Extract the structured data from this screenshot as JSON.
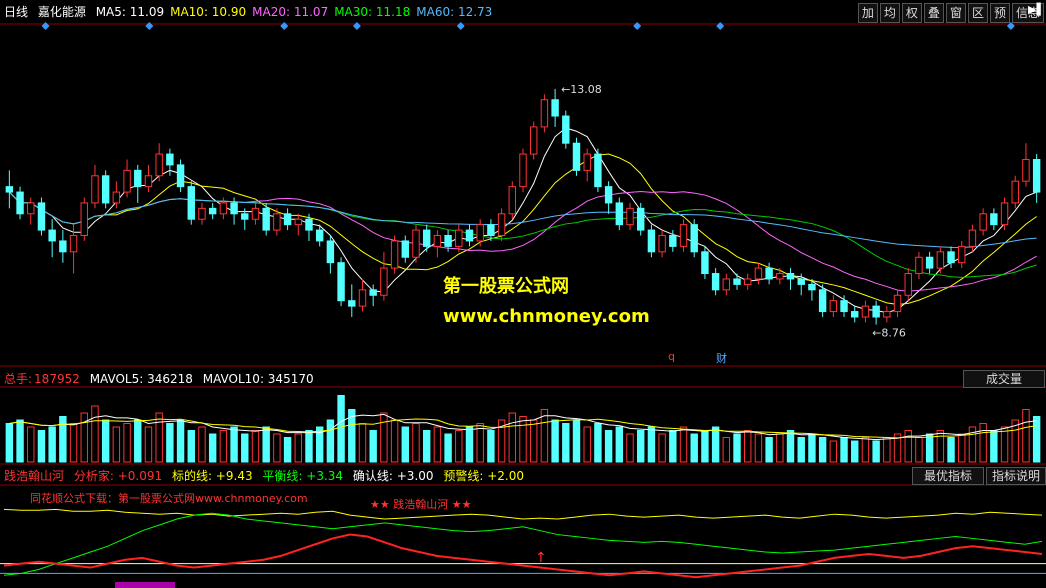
{
  "top_header": {
    "period": "日线",
    "stock": "嘉化能源",
    "ma": [
      {
        "label": "MA5: 11.09",
        "color": "#ffffff"
      },
      {
        "label": "MA10: 10.90",
        "color": "#ffff00"
      },
      {
        "label": "MA20: 11.07",
        "color": "#ff66ff"
      },
      {
        "label": "MA30: 11.18",
        "color": "#00ff00"
      },
      {
        "label": "MA60: 12.73",
        "color": "#55bbff"
      }
    ]
  },
  "toolbar": [
    "加",
    "均",
    "权",
    "叠",
    "窗",
    "区",
    "预",
    "信息"
  ],
  "watermark": {
    "title": "第一股票公式网",
    "url": "www.chnmoney.com"
  },
  "marker_labels": {
    "q": "q",
    "cai": "财"
  },
  "vol_header": {
    "total_label": "总手:",
    "total_value": "187952",
    "mavol5": "MAVOL5: 346218",
    "mavol10": "MAVOL10: 345170",
    "dropdown": "成交量"
  },
  "ind_header": {
    "name": "践浩翰山河",
    "fen": "分析家: +0.091",
    "biaode": "标的线: +9.43",
    "pingheng": "平衡线: +3.34",
    "queren": "确认线: +3.00",
    "yujing": "预警线: +2.00",
    "best_btn": "最优指标",
    "desc_btn": "指标说明"
  },
  "ind_note": "同花顺公式下载：第一股票公式网www.chnmoney.com",
  "ind_star_label": "践浩翰山河",
  "chart_data": {
    "type": "candlestick",
    "price_range": [
      8.2,
      14.0
    ],
    "high_label": "13.08",
    "low_label": "8.76",
    "diamond_positions": [
      0.04,
      0.14,
      0.27,
      0.34,
      0.44,
      0.61,
      0.69,
      0.97
    ],
    "ohlc": [
      [
        11.3,
        11.2,
        11.6,
        10.9
      ],
      [
        11.2,
        10.8,
        11.3,
        10.7
      ],
      [
        10.8,
        11.0,
        11.1,
        10.6
      ],
      [
        11.0,
        10.5,
        11.1,
        10.4
      ],
      [
        10.5,
        10.3,
        10.7,
        10.0
      ],
      [
        10.3,
        10.1,
        10.5,
        9.9
      ],
      [
        10.1,
        10.4,
        10.6,
        9.7
      ],
      [
        10.4,
        11.0,
        11.1,
        10.3
      ],
      [
        11.0,
        11.5,
        11.7,
        10.9
      ],
      [
        11.5,
        11.0,
        11.6,
        10.9
      ],
      [
        11.0,
        11.2,
        11.4,
        10.9
      ],
      [
        11.2,
        11.6,
        11.8,
        11.1
      ],
      [
        11.6,
        11.3,
        11.7,
        11.0
      ],
      [
        11.3,
        11.5,
        11.7,
        11.2
      ],
      [
        11.5,
        11.9,
        12.1,
        11.4
      ],
      [
        11.9,
        11.7,
        12.0,
        11.5
      ],
      [
        11.7,
        11.3,
        11.8,
        11.2
      ],
      [
        11.3,
        10.7,
        11.4,
        10.6
      ],
      [
        10.7,
        10.9,
        11.0,
        10.6
      ],
      [
        10.9,
        10.8,
        11.0,
        10.7
      ],
      [
        10.8,
        11.0,
        11.1,
        10.7
      ],
      [
        11.0,
        10.8,
        11.1,
        10.6
      ],
      [
        10.8,
        10.7,
        10.9,
        10.5
      ],
      [
        10.7,
        10.9,
        11.0,
        10.6
      ],
      [
        10.9,
        10.5,
        11.0,
        10.4
      ],
      [
        10.5,
        10.8,
        10.9,
        10.4
      ],
      [
        10.8,
        10.6,
        10.9,
        10.5
      ],
      [
        10.6,
        10.7,
        10.8,
        10.4
      ],
      [
        10.7,
        10.5,
        10.8,
        10.3
      ],
      [
        10.5,
        10.3,
        10.6,
        10.2
      ],
      [
        10.3,
        9.9,
        10.4,
        9.7
      ],
      [
        9.9,
        9.2,
        10.0,
        9.1
      ],
      [
        9.2,
        9.1,
        9.5,
        8.9
      ],
      [
        9.1,
        9.4,
        9.6,
        9.0
      ],
      [
        9.4,
        9.3,
        9.5,
        9.1
      ],
      [
        9.3,
        9.8,
        10.1,
        9.2
      ],
      [
        9.8,
        10.3,
        10.4,
        9.7
      ],
      [
        10.3,
        10.0,
        10.4,
        9.9
      ],
      [
        10.0,
        10.5,
        10.6,
        9.9
      ],
      [
        10.5,
        10.2,
        10.6,
        10.1
      ],
      [
        10.2,
        10.4,
        10.5,
        10.0
      ],
      [
        10.4,
        10.2,
        10.5,
        10.1
      ],
      [
        10.2,
        10.5,
        10.6,
        10.1
      ],
      [
        10.5,
        10.3,
        10.6,
        10.2
      ],
      [
        10.3,
        10.6,
        10.7,
        10.2
      ],
      [
        10.6,
        10.4,
        10.7,
        10.3
      ],
      [
        10.4,
        10.8,
        10.9,
        10.3
      ],
      [
        10.8,
        11.3,
        11.4,
        10.7
      ],
      [
        11.3,
        11.9,
        12.0,
        11.2
      ],
      [
        11.9,
        12.4,
        12.5,
        11.8
      ],
      [
        12.4,
        12.9,
        13.0,
        12.3
      ],
      [
        12.9,
        12.6,
        13.1,
        12.4
      ],
      [
        12.6,
        12.1,
        12.7,
        12.0
      ],
      [
        12.1,
        11.6,
        12.2,
        11.5
      ],
      [
        11.6,
        11.9,
        12.0,
        11.4
      ],
      [
        11.9,
        11.3,
        12.0,
        11.2
      ],
      [
        11.3,
        11.0,
        11.4,
        10.8
      ],
      [
        11.0,
        10.6,
        11.1,
        10.5
      ],
      [
        10.6,
        10.9,
        11.0,
        10.5
      ],
      [
        10.9,
        10.5,
        11.0,
        10.4
      ],
      [
        10.5,
        10.1,
        10.6,
        10.0
      ],
      [
        10.1,
        10.4,
        10.5,
        10.0
      ],
      [
        10.4,
        10.2,
        10.5,
        10.1
      ],
      [
        10.2,
        10.6,
        10.7,
        10.1
      ],
      [
        10.6,
        10.1,
        10.7,
        10.0
      ],
      [
        10.1,
        9.7,
        10.2,
        9.6
      ],
      [
        9.7,
        9.4,
        9.8,
        9.3
      ],
      [
        9.4,
        9.6,
        9.7,
        9.3
      ],
      [
        9.6,
        9.5,
        9.7,
        9.4
      ],
      [
        9.5,
        9.6,
        9.7,
        9.4
      ],
      [
        9.6,
        9.8,
        9.9,
        9.5
      ],
      [
        9.8,
        9.6,
        9.9,
        9.5
      ],
      [
        9.6,
        9.7,
        9.8,
        9.5
      ],
      [
        9.7,
        9.6,
        9.8,
        9.4
      ],
      [
        9.6,
        9.5,
        9.7,
        9.3
      ],
      [
        9.5,
        9.4,
        9.6,
        9.2
      ],
      [
        9.4,
        9.0,
        9.5,
        8.9
      ],
      [
        9.0,
        9.2,
        9.3,
        8.9
      ],
      [
        9.2,
        9.0,
        9.3,
        8.9
      ],
      [
        9.0,
        8.9,
        9.1,
        8.8
      ],
      [
        8.9,
        9.1,
        9.2,
        8.8
      ],
      [
        9.1,
        8.9,
        9.2,
        8.76
      ],
      [
        8.9,
        9.0,
        9.1,
        8.8
      ],
      [
        9.0,
        9.3,
        9.4,
        8.9
      ],
      [
        9.3,
        9.7,
        9.8,
        9.2
      ],
      [
        9.7,
        10.0,
        10.1,
        9.6
      ],
      [
        10.0,
        9.8,
        10.1,
        9.7
      ],
      [
        9.8,
        10.1,
        10.2,
        9.7
      ],
      [
        10.1,
        9.9,
        10.2,
        9.8
      ],
      [
        9.9,
        10.2,
        10.3,
        9.8
      ],
      [
        10.2,
        10.5,
        10.6,
        10.1
      ],
      [
        10.5,
        10.8,
        10.9,
        10.4
      ],
      [
        10.8,
        10.6,
        10.9,
        10.5
      ],
      [
        10.6,
        11.0,
        11.1,
        10.5
      ],
      [
        11.0,
        11.4,
        11.5,
        10.9
      ],
      [
        11.4,
        11.8,
        12.1,
        11.3
      ],
      [
        11.8,
        11.2,
        11.9,
        11.0
      ]
    ],
    "volumes": [
      0.55,
      0.6,
      0.5,
      0.45,
      0.5,
      0.65,
      0.55,
      0.7,
      0.8,
      0.6,
      0.5,
      0.55,
      0.6,
      0.5,
      0.7,
      0.55,
      0.6,
      0.45,
      0.5,
      0.4,
      0.45,
      0.5,
      0.4,
      0.45,
      0.5,
      0.4,
      0.35,
      0.4,
      0.45,
      0.5,
      0.6,
      0.95,
      0.75,
      0.55,
      0.45,
      0.7,
      0.6,
      0.5,
      0.55,
      0.45,
      0.5,
      0.4,
      0.45,
      0.5,
      0.55,
      0.45,
      0.6,
      0.7,
      0.65,
      0.6,
      0.75,
      0.6,
      0.55,
      0.6,
      0.5,
      0.55,
      0.45,
      0.5,
      0.4,
      0.45,
      0.5,
      0.4,
      0.45,
      0.5,
      0.4,
      0.45,
      0.5,
      0.35,
      0.4,
      0.45,
      0.4,
      0.35,
      0.4,
      0.45,
      0.35,
      0.4,
      0.35,
      0.3,
      0.35,
      0.3,
      0.35,
      0.3,
      0.35,
      0.4,
      0.45,
      0.35,
      0.4,
      0.45,
      0.35,
      0.4,
      0.5,
      0.55,
      0.45,
      0.5,
      0.6,
      0.75,
      0.65
    ],
    "indicator": {
      "yellow": [
        0.78,
        0.77,
        0.77,
        0.78,
        0.76,
        0.76,
        0.77,
        0.75,
        0.74,
        0.73,
        0.74,
        0.72,
        0.73,
        0.71,
        0.72,
        0.73,
        0.74,
        0.73,
        0.75,
        0.76,
        0.72,
        0.7,
        0.68,
        0.69,
        0.7,
        0.71,
        0.72,
        0.73,
        0.72,
        0.7,
        0.68,
        0.69,
        0.68,
        0.7,
        0.72,
        0.73,
        0.71,
        0.7,
        0.71,
        0.72,
        0.7,
        0.69,
        0.7,
        0.71,
        0.72,
        0.7,
        0.69,
        0.71,
        0.73,
        0.72,
        0.7,
        0.69,
        0.7,
        0.71,
        0.72,
        0.74,
        0.73,
        0.75,
        0.74,
        0.73,
        0.72
      ],
      "green": [
        0.1,
        0.12,
        0.16,
        0.22,
        0.28,
        0.34,
        0.4,
        0.48,
        0.56,
        0.62,
        0.68,
        0.72,
        0.74,
        0.72,
        0.68,
        0.66,
        0.64,
        0.62,
        0.6,
        0.58,
        0.6,
        0.62,
        0.64,
        0.62,
        0.6,
        0.58,
        0.56,
        0.55,
        0.56,
        0.58,
        0.6,
        0.56,
        0.52,
        0.5,
        0.48,
        0.46,
        0.45,
        0.44,
        0.45,
        0.44,
        0.42,
        0.4,
        0.38,
        0.36,
        0.34,
        0.33,
        0.34,
        0.35,
        0.36,
        0.38,
        0.4,
        0.42,
        0.44,
        0.46,
        0.48,
        0.5,
        0.48,
        0.46,
        0.44,
        0.42,
        0.45
      ],
      "red": [
        0.2,
        0.22,
        0.24,
        0.22,
        0.2,
        0.18,
        0.22,
        0.26,
        0.28,
        0.24,
        0.2,
        0.18,
        0.2,
        0.22,
        0.24,
        0.26,
        0.3,
        0.36,
        0.42,
        0.48,
        0.52,
        0.5,
        0.44,
        0.38,
        0.34,
        0.3,
        0.28,
        0.26,
        0.24,
        0.22,
        0.2,
        0.18,
        0.16,
        0.14,
        0.12,
        0.1,
        0.12,
        0.14,
        0.12,
        0.1,
        0.08,
        0.1,
        0.12,
        0.14,
        0.16,
        0.18,
        0.2,
        0.24,
        0.28,
        0.3,
        0.32,
        0.3,
        0.28,
        0.3,
        0.34,
        0.38,
        0.4,
        0.38,
        0.36,
        0.34,
        0.32
      ],
      "hlines": [
        0.12,
        0.22
      ]
    }
  }
}
